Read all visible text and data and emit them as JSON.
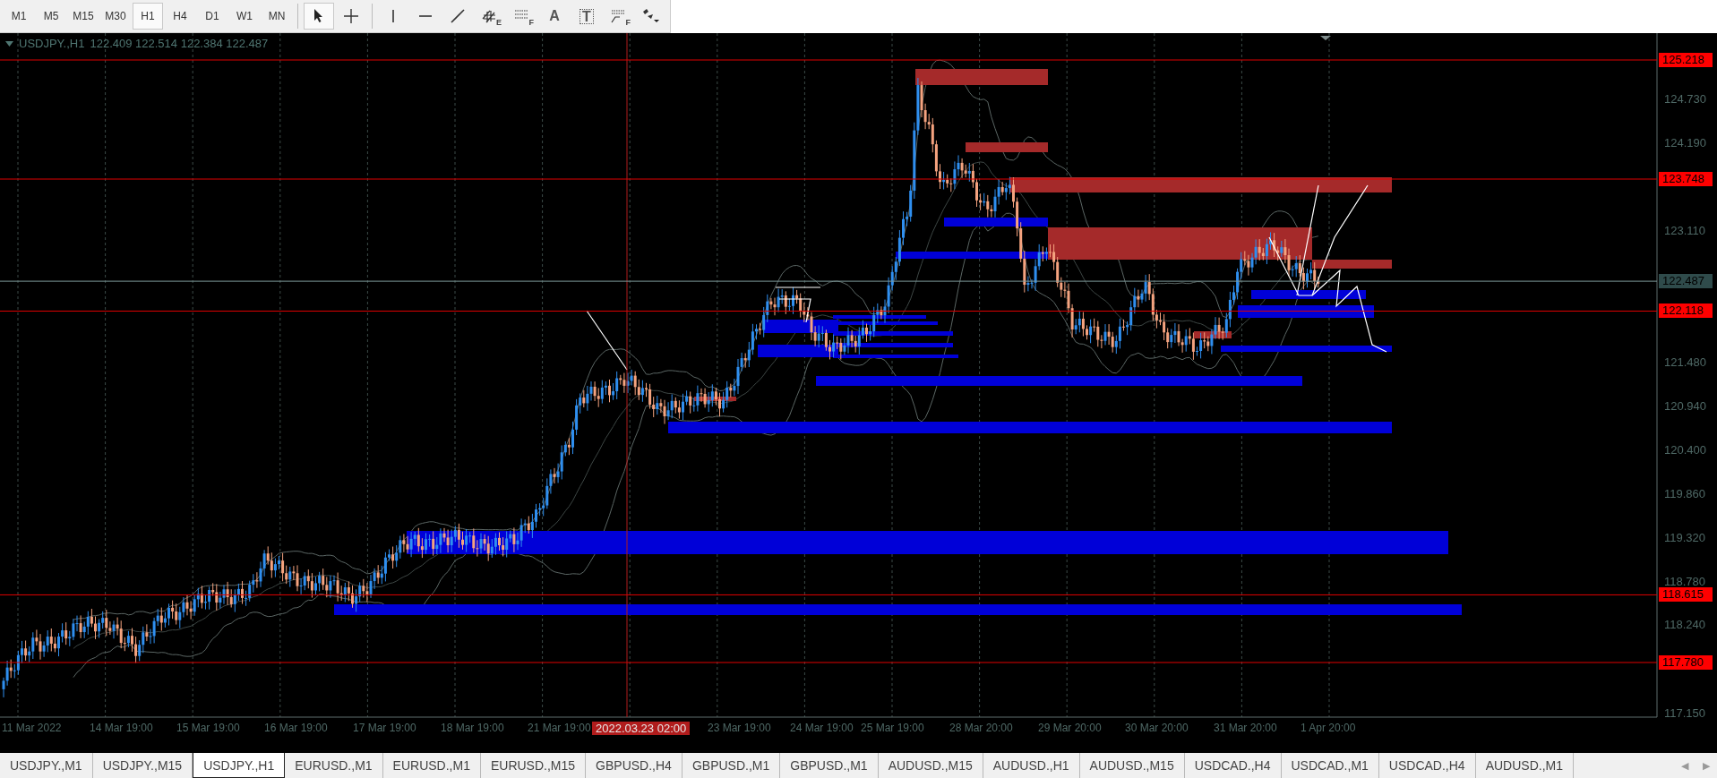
{
  "toolbar": {
    "timeframes": [
      {
        "label": "M1",
        "selected": false
      },
      {
        "label": "M5",
        "selected": false
      },
      {
        "label": "M15",
        "selected": false
      },
      {
        "label": "M30",
        "selected": false
      },
      {
        "label": "H1",
        "selected": true
      },
      {
        "label": "H4",
        "selected": false
      },
      {
        "label": "D1",
        "selected": false
      },
      {
        "label": "W1",
        "selected": false
      },
      {
        "label": "MN",
        "selected": false
      }
    ],
    "tools": [
      {
        "kind": "cursor",
        "selected": true
      },
      {
        "kind": "crosshair",
        "selected": false
      },
      {
        "kind": "separator"
      },
      {
        "kind": "vline",
        "selected": false
      },
      {
        "kind": "hline",
        "selected": false
      },
      {
        "kind": "trend",
        "selected": false
      },
      {
        "kind": "channel",
        "letter": "E",
        "selected": false
      },
      {
        "kind": "levels",
        "letter": "F",
        "selected": false
      },
      {
        "kind": "text",
        "label": "A",
        "selected": false
      },
      {
        "kind": "label",
        "label": "T",
        "selected": false
      },
      {
        "kind": "fibo",
        "letter": "F",
        "selected": false
      },
      {
        "kind": "shapes",
        "selected": false
      }
    ]
  },
  "chart": {
    "symbol": "USDJPY.,H1",
    "ohlc": "122.409 122.514 122.384 122.487",
    "price_axis": [
      "124.730",
      "124.190",
      "123.110",
      "121.480",
      "120.940",
      "120.400",
      "119.860",
      "119.320",
      "118.780",
      "118.240",
      "117.150"
    ],
    "price_tags": [
      {
        "text": "125.218",
        "kind": "level"
      },
      {
        "text": "123.748",
        "kind": "level"
      },
      {
        "text": "122.487",
        "kind": "bid"
      },
      {
        "text": "122.118",
        "kind": "level"
      },
      {
        "text": "118.615",
        "kind": "level"
      },
      {
        "text": "117.780",
        "kind": "level"
      }
    ],
    "time_axis": [
      "11 Mar 2022",
      "14 Mar 19:00",
      "15 Mar 19:00",
      "16 Mar 19:00",
      "17 Mar 19:00",
      "18 Mar 19:00",
      "21 Mar 19:00",
      "23 Mar 19:00",
      "24 Mar 19:00",
      "25 Mar 19:00",
      "28 Mar 20:00",
      "29 Mar 20:00",
      "30 Mar 20:00",
      "31 Mar 20:00",
      "1 Apr 20:00"
    ],
    "crosshair_time": "2022.03.23 02:00"
  },
  "tabs": [
    {
      "label": "USDJPY.,M1",
      "selected": false
    },
    {
      "label": "USDJPY.,M15",
      "selected": false
    },
    {
      "label": "USDJPY.,H1",
      "selected": true
    },
    {
      "label": "EURUSD.,M1",
      "selected": false
    },
    {
      "label": "EURUSD.,M1",
      "selected": false
    },
    {
      "label": "EURUSD.,M15",
      "selected": false
    },
    {
      "label": "GBPUSD.,H4",
      "selected": false
    },
    {
      "label": "GBPUSD.,M1",
      "selected": false
    },
    {
      "label": "GBPUSD.,M1",
      "selected": false
    },
    {
      "label": "AUDUSD.,M15",
      "selected": false
    },
    {
      "label": "AUDUSD.,H1",
      "selected": false
    },
    {
      "label": "AUDUSD.,M15",
      "selected": false
    },
    {
      "label": "USDCAD.,H4",
      "selected": false
    },
    {
      "label": "USDCAD.,M1",
      "selected": false
    },
    {
      "label": "USDCAD.,H4",
      "selected": false
    },
    {
      "label": "AUDUSD.,M1",
      "selected": false
    }
  ],
  "tab_scroll": [
    "◀",
    "▶"
  ]
}
